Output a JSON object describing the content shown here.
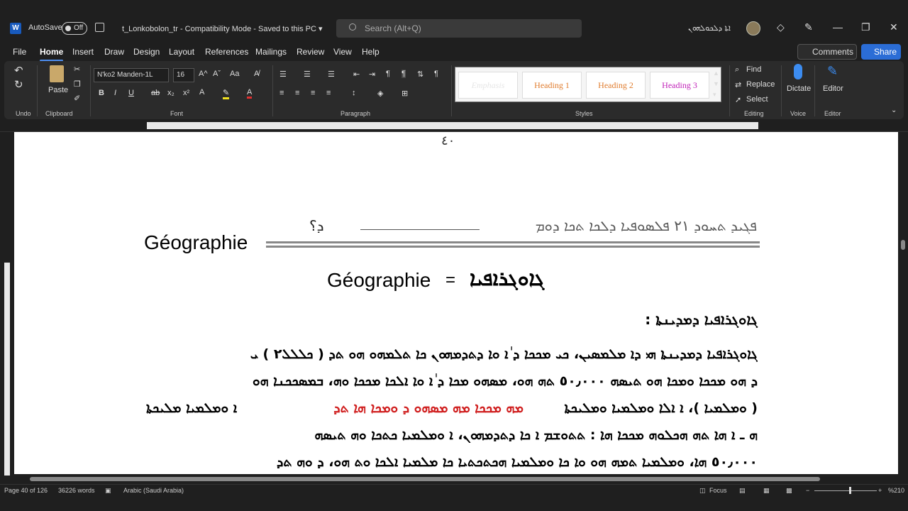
{
  "window": {
    "autosave_label": "AutoSave",
    "autosave_state": "Off",
    "doc_title": "t_Lonkobolon_tr  -  Compatibility Mode  -  Saved to this PC ▾",
    "search_placeholder": "Search (Alt+Q)",
    "user_name": "ܐܬܐ ܕܠܟܘܠܗܘܢ",
    "min": "—",
    "max": "❐",
    "close": "✕"
  },
  "menu": {
    "items": [
      "File",
      "Home",
      "Insert",
      "Draw",
      "Design",
      "Layout",
      "References",
      "Mailings",
      "Review",
      "View",
      "Help"
    ],
    "comments": "Comments",
    "share": "Share"
  },
  "ribbon": {
    "undo_label": "Undo",
    "clipboard_label": "Clipboard",
    "paste": "Paste",
    "font_name": "N'ko2 Manden-1L",
    "font_size": "16",
    "font_label": "Font",
    "paragraph_label": "Paragraph",
    "styles_label": "Styles",
    "styles": [
      "Emphasis",
      "Heading 1",
      "Heading 2",
      "Heading 3"
    ],
    "style_colors": [
      "#000000",
      "#e07b2c",
      "#e07b2c",
      "#c020b8"
    ],
    "find": "Find",
    "replace": "Replace",
    "select": "Select",
    "editing_label": "Editing",
    "dictate": "Dictate",
    "voice_label": "Voice",
    "editor": "Editor",
    "editor_label": "Editor"
  },
  "document": {
    "page_number": "٤٠",
    "header_right": "ܦܓܝܕ ܬܚܘܕ ٢١ ܦܠܣܘܦܝܐ ܕܠܟܐ ܬܟܐ ܕܘܡ",
    "header_mark": "ܕ؟",
    "heading_fr": "Géographie",
    "title_fr": "Géographie",
    "title_eq": "=",
    "title_ar": "ܓܐܘܓܪܐܦܝܐ",
    "subheading": "ܓܐܘܓܪܐܦܝܐ ܕܡܕܝܢܬܐ :",
    "paragraph_lines": [
      "ܓܐܘܓܪܐܦܝܐ ܕܡܕܝܢܬܐ ܗܝ ܕܐ ܡܠܡܣܝܢ، ܟܝ ܡܟܟܐ ܕ ٰܐ ܘܐ ܕܬܕܡܗܘܢ ܟܐ ܬܠܡܗܘ ܗܘ ܬܕ ( ܟܠܠܠ٢ ) ܝ",
      "ܕ ܗܘ ܡܟܟܐ ܘܡܟܐ ܗܘ ܬܝܣܗ ٥٠٫٠٠٠ ܬܗ ܗܘ، ܡܣܗܘ ܡܟܐ ܕ ٰܐ ܘܐ ܐܠܟܐ ܡܟܟܐ ܘܗ، ܒܡܣܟܟܢܐ ܗܘ",
      "ܐ ܘܡܠܡܝܐ ܡܠܝܟܬܐ ",
      "ܗ ـ ܐ ܗܐ ܬܗ ܗܟܠܘܗ ܡܟܟܐ ܗܐ : ܬܬܘܫܡ ܐ ܟܐ ܕܬܕܡܗܘܢ، ܐ ܘܡܠܡܝܐ ܟܬܟܐ ܘܗ ܬܝܣܗ",
      "٥٠٫٠٠٠ ܗܐ، ܘܡܠܡܝܐ ܬܡܗ ܗܘ ܘܐ ܟܐ ܘܡܠܡܝܐ ܗܟܬܟܬܝܐ ܟܐ ܡܠܡܝܐ ܐܠܟܐ ܘܬ ܗܘ، ܕ ܘܗ ܬܕ"
    ],
    "line3_red": "ܡܗ ܡܟܟܐ ܡܗ ܡܣܗܘ ܕ ܘܡܟܐ ܗܐ ܬܕ",
    "line3_end": "( ܘܡܠܡܝܐ )، ܐ ܐܠܐ ܘܡܠܡܝܐ ܘܡܠܝܟܬܐ"
  },
  "status": {
    "page": "Page 40 of 126",
    "words": "36226 words",
    "language": "Arabic (Saudi Arabia)",
    "focus": "Focus",
    "zoom": "%210"
  }
}
